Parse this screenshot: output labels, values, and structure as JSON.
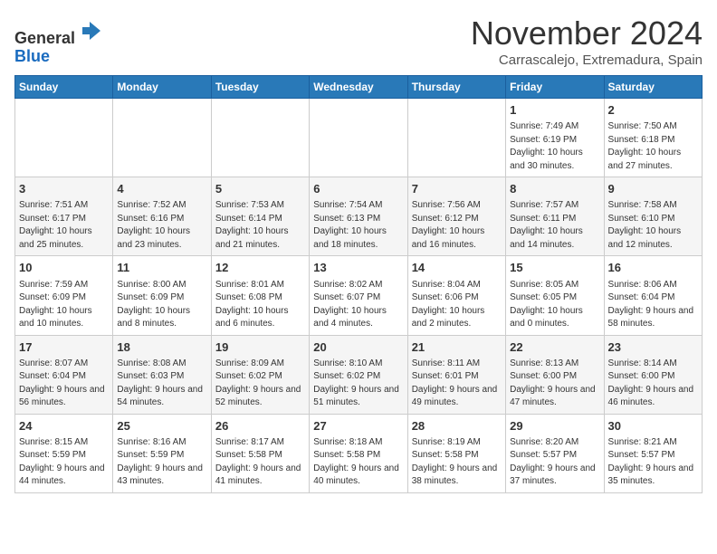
{
  "logo": {
    "general": "General",
    "blue": "Blue"
  },
  "title": "November 2024",
  "subtitle": "Carrascalejo, Extremadura, Spain",
  "headers": [
    "Sunday",
    "Monday",
    "Tuesday",
    "Wednesday",
    "Thursday",
    "Friday",
    "Saturday"
  ],
  "weeks": [
    [
      {
        "day": "",
        "info": ""
      },
      {
        "day": "",
        "info": ""
      },
      {
        "day": "",
        "info": ""
      },
      {
        "day": "",
        "info": ""
      },
      {
        "day": "",
        "info": ""
      },
      {
        "day": "1",
        "info": "Sunrise: 7:49 AM\nSunset: 6:19 PM\nDaylight: 10 hours and 30 minutes."
      },
      {
        "day": "2",
        "info": "Sunrise: 7:50 AM\nSunset: 6:18 PM\nDaylight: 10 hours and 27 minutes."
      }
    ],
    [
      {
        "day": "3",
        "info": "Sunrise: 7:51 AM\nSunset: 6:17 PM\nDaylight: 10 hours and 25 minutes."
      },
      {
        "day": "4",
        "info": "Sunrise: 7:52 AM\nSunset: 6:16 PM\nDaylight: 10 hours and 23 minutes."
      },
      {
        "day": "5",
        "info": "Sunrise: 7:53 AM\nSunset: 6:14 PM\nDaylight: 10 hours and 21 minutes."
      },
      {
        "day": "6",
        "info": "Sunrise: 7:54 AM\nSunset: 6:13 PM\nDaylight: 10 hours and 18 minutes."
      },
      {
        "day": "7",
        "info": "Sunrise: 7:56 AM\nSunset: 6:12 PM\nDaylight: 10 hours and 16 minutes."
      },
      {
        "day": "8",
        "info": "Sunrise: 7:57 AM\nSunset: 6:11 PM\nDaylight: 10 hours and 14 minutes."
      },
      {
        "day": "9",
        "info": "Sunrise: 7:58 AM\nSunset: 6:10 PM\nDaylight: 10 hours and 12 minutes."
      }
    ],
    [
      {
        "day": "10",
        "info": "Sunrise: 7:59 AM\nSunset: 6:09 PM\nDaylight: 10 hours and 10 minutes."
      },
      {
        "day": "11",
        "info": "Sunrise: 8:00 AM\nSunset: 6:09 PM\nDaylight: 10 hours and 8 minutes."
      },
      {
        "day": "12",
        "info": "Sunrise: 8:01 AM\nSunset: 6:08 PM\nDaylight: 10 hours and 6 minutes."
      },
      {
        "day": "13",
        "info": "Sunrise: 8:02 AM\nSunset: 6:07 PM\nDaylight: 10 hours and 4 minutes."
      },
      {
        "day": "14",
        "info": "Sunrise: 8:04 AM\nSunset: 6:06 PM\nDaylight: 10 hours and 2 minutes."
      },
      {
        "day": "15",
        "info": "Sunrise: 8:05 AM\nSunset: 6:05 PM\nDaylight: 10 hours and 0 minutes."
      },
      {
        "day": "16",
        "info": "Sunrise: 8:06 AM\nSunset: 6:04 PM\nDaylight: 9 hours and 58 minutes."
      }
    ],
    [
      {
        "day": "17",
        "info": "Sunrise: 8:07 AM\nSunset: 6:04 PM\nDaylight: 9 hours and 56 minutes."
      },
      {
        "day": "18",
        "info": "Sunrise: 8:08 AM\nSunset: 6:03 PM\nDaylight: 9 hours and 54 minutes."
      },
      {
        "day": "19",
        "info": "Sunrise: 8:09 AM\nSunset: 6:02 PM\nDaylight: 9 hours and 52 minutes."
      },
      {
        "day": "20",
        "info": "Sunrise: 8:10 AM\nSunset: 6:02 PM\nDaylight: 9 hours and 51 minutes."
      },
      {
        "day": "21",
        "info": "Sunrise: 8:11 AM\nSunset: 6:01 PM\nDaylight: 9 hours and 49 minutes."
      },
      {
        "day": "22",
        "info": "Sunrise: 8:13 AM\nSunset: 6:00 PM\nDaylight: 9 hours and 47 minutes."
      },
      {
        "day": "23",
        "info": "Sunrise: 8:14 AM\nSunset: 6:00 PM\nDaylight: 9 hours and 46 minutes."
      }
    ],
    [
      {
        "day": "24",
        "info": "Sunrise: 8:15 AM\nSunset: 5:59 PM\nDaylight: 9 hours and 44 minutes."
      },
      {
        "day": "25",
        "info": "Sunrise: 8:16 AM\nSunset: 5:59 PM\nDaylight: 9 hours and 43 minutes."
      },
      {
        "day": "26",
        "info": "Sunrise: 8:17 AM\nSunset: 5:58 PM\nDaylight: 9 hours and 41 minutes."
      },
      {
        "day": "27",
        "info": "Sunrise: 8:18 AM\nSunset: 5:58 PM\nDaylight: 9 hours and 40 minutes."
      },
      {
        "day": "28",
        "info": "Sunrise: 8:19 AM\nSunset: 5:58 PM\nDaylight: 9 hours and 38 minutes."
      },
      {
        "day": "29",
        "info": "Sunrise: 8:20 AM\nSunset: 5:57 PM\nDaylight: 9 hours and 37 minutes."
      },
      {
        "day": "30",
        "info": "Sunrise: 8:21 AM\nSunset: 5:57 PM\nDaylight: 9 hours and 35 minutes."
      }
    ]
  ]
}
